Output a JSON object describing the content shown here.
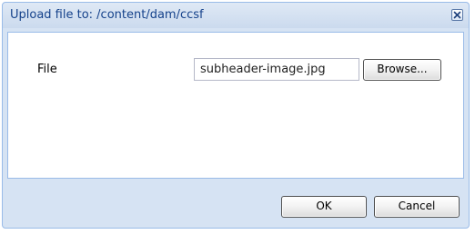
{
  "dialog": {
    "title": "Upload file to: /content/dam/ccsf",
    "close_icon": "close-icon"
  },
  "form": {
    "file_label": "File",
    "file_value": "subheader-image.jpg",
    "browse_label": "Browse..."
  },
  "footer": {
    "ok_label": "OK",
    "cancel_label": "Cancel"
  }
}
